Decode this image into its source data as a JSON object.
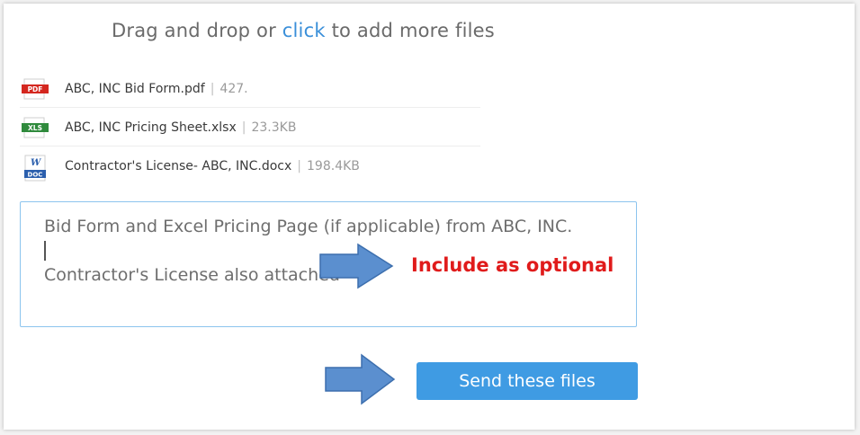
{
  "dropzone": {
    "prefix": "Drag and drop or ",
    "link": "click",
    "suffix": " to add more files"
  },
  "files": [
    {
      "name": "ABC, INC Bid Form.pdf",
      "separator": "|",
      "size": "427.",
      "icon": "pdf-file-icon",
      "icon_label": "PDF",
      "color": "#d4271f"
    },
    {
      "name": "ABC, INC Pricing Sheet.xlsx",
      "separator": "|",
      "size": "23.3KB",
      "icon": "excel-file-icon",
      "icon_label": "XLS",
      "color": "#2f8a3c"
    },
    {
      "name": "Contractor's License- ABC, INC.docx",
      "separator": "|",
      "size": "198.4KB",
      "icon": "word-file-icon",
      "icon_label": "DOC",
      "color": "#2b5fad"
    }
  ],
  "message": {
    "line1": "Bid Form and Excel Pricing Page (if applicable) from ABC, INC.",
    "line2": "Contractor's License also attached"
  },
  "annotation": {
    "text": "Include as optional",
    "color": "#e01b1b"
  },
  "send_button": {
    "label": "Send these files",
    "color": "#3f9be3"
  }
}
